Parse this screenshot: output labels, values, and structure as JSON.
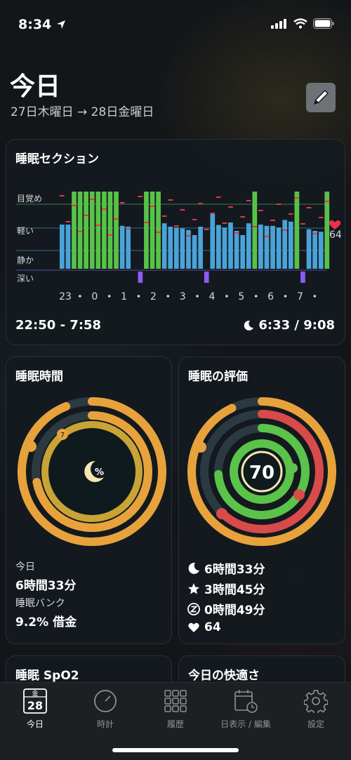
{
  "status_bar": {
    "time": "8:34"
  },
  "header": {
    "title": "今日",
    "subtitle": "27日木曜日 → 28日金曜日"
  },
  "sleep_section": {
    "title": "睡眠セクション",
    "stage_labels": [
      "目覚め",
      "軽い",
      "静か",
      "深い"
    ],
    "hour_labels": [
      "23",
      "0",
      "1",
      "2",
      "3",
      "4",
      "5",
      "6",
      "7"
    ],
    "heart_rate": "64",
    "time_range": "22:50 - 7:58",
    "duration": "6:33 / 9:08",
    "colors": {
      "awake": "#58c248",
      "light": "#4aa3d8",
      "deep": "#8b5cf6",
      "heart": "#e8334b"
    },
    "chart_data": {
      "type": "bar",
      "stages_per_interval": [
        "light",
        "light",
        "awake",
        "awake",
        "awake",
        "awake",
        "awake",
        "awake",
        "awake",
        "awake",
        "light",
        "light",
        "none",
        "deep",
        "awake",
        "awake",
        "awake",
        "light",
        "light",
        "light",
        "light",
        "light",
        "light",
        "light",
        "deep",
        "light",
        "light",
        "light",
        "light",
        "light",
        "light",
        "light",
        "awake",
        "light",
        "light",
        "light",
        "light",
        "light",
        "light",
        "awake",
        "deep",
        "light",
        "light",
        "light",
        "awake"
      ],
      "light_levels": [
        0.55,
        0.55,
        1,
        1,
        1,
        1,
        1,
        1,
        1,
        1,
        0.52,
        0.5,
        0,
        0,
        1,
        1,
        1,
        0.58,
        0.5,
        0.48,
        0.46,
        0.42,
        0.3,
        0.5,
        0,
        0.8,
        0.54,
        0.48,
        0.6,
        0.4,
        0.3,
        0.58,
        1,
        0.55,
        0.52,
        0.52,
        0.48,
        0.66,
        0.62,
        1,
        0,
        0.44,
        0.4,
        0.38,
        1
      ]
    }
  },
  "sleep_time": {
    "title": "睡眠時間",
    "center_symbol": "%",
    "today_label": "今日",
    "today_value": "6時間33分",
    "bank_label": "睡眠バンク",
    "bank_value": "9.2% 借金",
    "badge": "7",
    "chart_data": {
      "type": "pie",
      "outer_ring_fraction": 0.94,
      "inner_ring_fraction": 0.72
    }
  },
  "sleep_score": {
    "title": "睡眠の評価",
    "score": "70",
    "rows": [
      {
        "icon": "moon-icon",
        "value": "6時間33分"
      },
      {
        "icon": "star-icon",
        "value": "3時間45分"
      },
      {
        "icon": "z-icon",
        "value": "0時間49分"
      },
      {
        "icon": "heart-icon",
        "value": "64"
      }
    ],
    "colors": {
      "ring_orange": "#e8a23c",
      "ring_red": "#d94a4a",
      "ring_green": "#5bc34a"
    },
    "chart_data": {
      "type": "pie",
      "score": 70,
      "orange_fraction": 0.93,
      "red_fraction": 0.62,
      "green_fraction": 0.74
    }
  },
  "cards_bottom": {
    "spo2_title": "睡眠 SpO2",
    "comfort_title": "今日の快適さ"
  },
  "tabbar": {
    "calendar_month": "金",
    "calendar_day": "28",
    "tabs": [
      {
        "label": "今日",
        "icon": "calendar-icon"
      },
      {
        "label": "時計",
        "icon": "clock-icon"
      },
      {
        "label": "履歴",
        "icon": "grid-icon"
      },
      {
        "label": "日表示 / 編集",
        "icon": "day-edit-icon"
      },
      {
        "label": "設定",
        "icon": "gear-icon"
      }
    ]
  }
}
